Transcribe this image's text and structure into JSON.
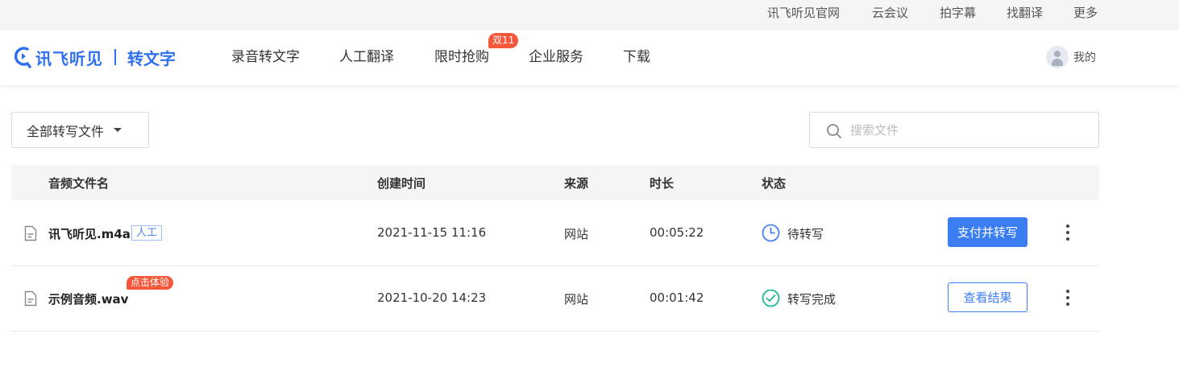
{
  "topbar": {
    "links": [
      "讯飞听见官网",
      "云会议",
      "拍字幕",
      "找翻译",
      "更多"
    ]
  },
  "header": {
    "brand": "讯飞听见",
    "product": "转文字",
    "nav": [
      "录音转文字",
      "人工翻译",
      "限时抢购",
      "企业服务",
      "下载"
    ],
    "promo_badge": "双11",
    "user_label": "我的"
  },
  "toolbar": {
    "filter_label": "全部转写文件",
    "search_placeholder": "搜索文件"
  },
  "table": {
    "columns": [
      "音频文件名",
      "创建时间",
      "来源",
      "时长",
      "状态"
    ],
    "rows": [
      {
        "name": "讯飞听见.m4a",
        "tag": "人工",
        "created": "2021-11-15 11:16",
        "source": "网站",
        "duration": "00:05:22",
        "status": "待转写",
        "action": "支付并转写"
      },
      {
        "name": "示例音频.wav",
        "tag": "点击体验",
        "created": "2021-10-20 14:23",
        "source": "网站",
        "duration": "00:01:42",
        "status": "转写完成",
        "action": "查看结果"
      }
    ]
  },
  "colors": {
    "brand_blue": "#2e6ff0",
    "button_blue": "#3b7ef2",
    "promo_red": "#f4573a",
    "pending_icon": "#4a82f2",
    "done_icon": "#22b89a"
  },
  "icons": {
    "logo": "logo-icon",
    "user": "avatar-icon",
    "search": "search-icon",
    "file": "file-icon",
    "pending": "clock-icon",
    "done": "check-circle-icon",
    "more": "more-vertical-icon",
    "dropdown": "caret-down-icon"
  }
}
